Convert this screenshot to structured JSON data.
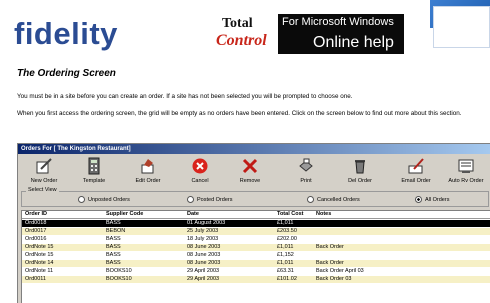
{
  "header": {
    "logo_text": "fidelity",
    "total_control_line1": "Total",
    "total_control_line2": "Control",
    "help_line1": "For Microsoft Windows",
    "help_line2": "Online help"
  },
  "page": {
    "title": "The Ordering Screen",
    "para1": "You must be in a site before you can create an order. If a site has not been selected you will be prompted to choose one.",
    "para2": "When you first access the ordering screen, the grid will be empty as no orders have been entered. Click on the screen below to find out more about this section."
  },
  "window": {
    "title": "Orders For [ The Kingston Restaurant]"
  },
  "toolbar": [
    {
      "label": "New Order",
      "icon": "pencil-paper-icon"
    },
    {
      "label": "Template",
      "icon": "calculator-icon"
    },
    {
      "label": "Edit Order",
      "icon": "edit-hand-icon"
    },
    {
      "label": "Cancel",
      "icon": "cancel-icon"
    },
    {
      "label": "Remove",
      "icon": "remove-x-icon"
    },
    {
      "label": "Print",
      "icon": "print-icon"
    },
    {
      "label": "Del Order",
      "icon": "trash-icon"
    },
    {
      "label": "Email Order",
      "icon": "email-icon"
    },
    {
      "label": "Auto Rv Order",
      "icon": "auto-order-icon"
    }
  ],
  "select_view": {
    "legend": "Select View",
    "options": [
      "Unposted Orders",
      "Posted Orders",
      "Cancelled Orders",
      "All Orders"
    ],
    "selected": "All Orders"
  },
  "grid": {
    "columns": [
      "Order ID",
      "Supplier Code",
      "Date",
      "Total Cost",
      "Notes"
    ],
    "rows": [
      {
        "order_id": "Ord0018",
        "supplier": "BASS",
        "date": "01 August 2003",
        "cost": "£1,011",
        "notes": ""
      },
      {
        "order_id": "Ord0017",
        "supplier": "BEBON",
        "date": "25 July 2003",
        "cost": "£203.50",
        "notes": ""
      },
      {
        "order_id": "Ord0016",
        "supplier": "BASS",
        "date": "18 July 2003",
        "cost": "£202.00",
        "notes": ""
      },
      {
        "order_id": "OrdNote 15",
        "supplier": "BASS",
        "date": "08 June 2003",
        "cost": "£1,011",
        "notes": "Back Order"
      },
      {
        "order_id": "OrdNote 15",
        "supplier": "BASS",
        "date": "08 June 2003",
        "cost": "£1,152",
        "notes": ""
      },
      {
        "order_id": "OrdNote 14",
        "supplier": "BASS",
        "date": "08 June 2003",
        "cost": "£1,011",
        "notes": "Back Order"
      },
      {
        "order_id": "OrdNote 11",
        "supplier": "BOOKS10",
        "date": "29 April 2003",
        "cost": "£63.31",
        "notes": "Back Order April 03"
      },
      {
        "order_id": "Ord0011",
        "supplier": "BOOKS10",
        "date": "29 April 2003",
        "cost": "£101.02",
        "notes": "Back Order 03"
      }
    ]
  }
}
